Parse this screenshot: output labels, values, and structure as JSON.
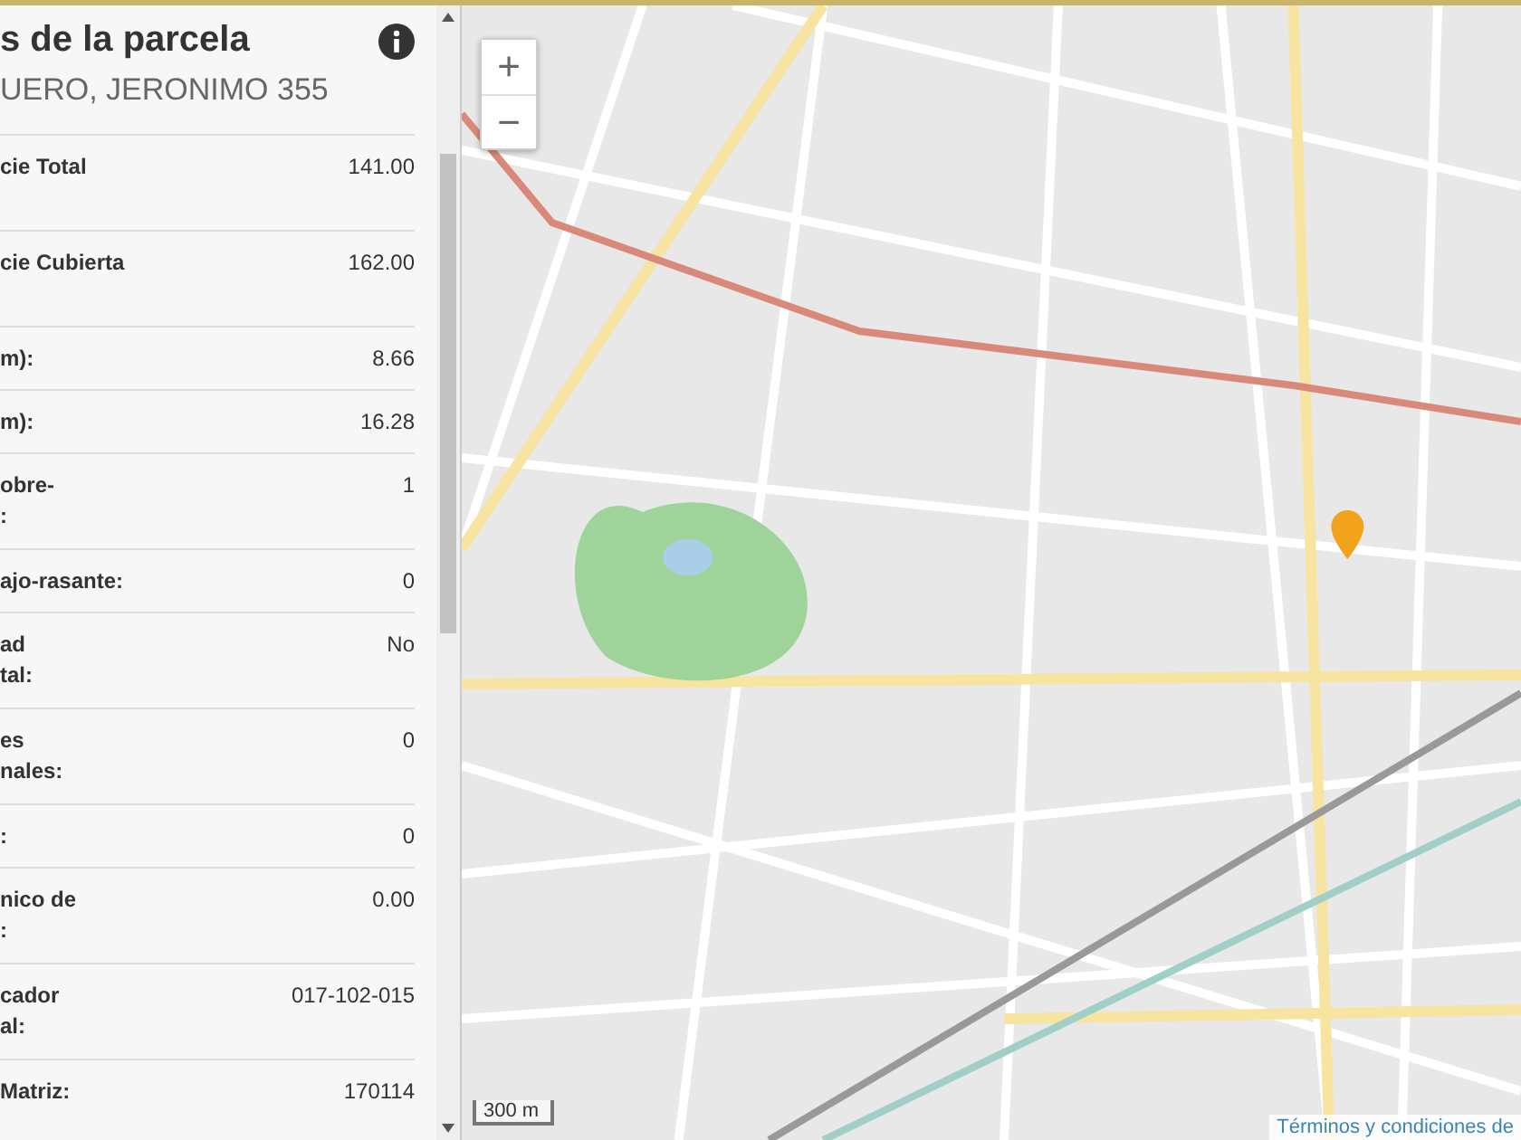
{
  "panel": {
    "title": "s de la parcela",
    "address": "UERO, JERONIMO 355",
    "rows": [
      {
        "label": "cie Total",
        "value": "141.00",
        "tall": true
      },
      {
        "label": "cie Cubierta",
        "value": "162.00",
        "tall": true
      },
      {
        "label": "m):",
        "value": "8.66",
        "tall": false
      },
      {
        "label": "m):",
        "value": "16.28",
        "tall": false
      },
      {
        "label": "obre-\n:",
        "value": "1",
        "tall": true
      },
      {
        "label": "ajo-rasante:",
        "value": "0",
        "tall": false
      },
      {
        "label": "ad\ntal:",
        "value": "No",
        "tall": true
      },
      {
        "label": "es\nnales:",
        "value": "0",
        "tall": true
      },
      {
        "label": ":",
        "value": "0",
        "tall": false
      },
      {
        "label": "nico de\n:",
        "value": "0.00",
        "tall": true
      },
      {
        "label": "cador\nal:",
        "value": "017-102-015",
        "tall": true
      },
      {
        "label": "Matriz:",
        "value": "170114",
        "tall": false
      }
    ]
  },
  "map": {
    "zoom_in": "+",
    "zoom_out": "−",
    "scale": "300 m",
    "terms_link": "Términos y condiciones de"
  }
}
